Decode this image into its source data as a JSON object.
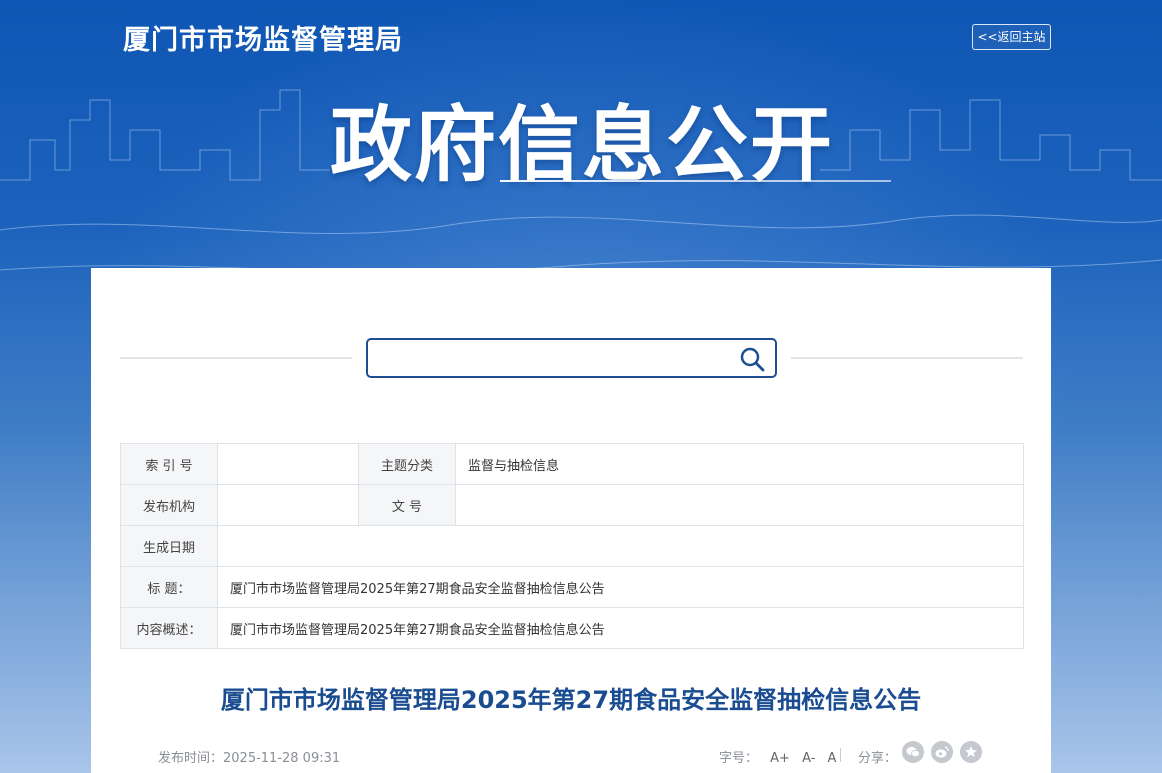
{
  "header": {
    "site_name": "厦门市市场监督管理局",
    "back_label": "<<返回主站",
    "banner_title": "政府信息公开"
  },
  "search": {
    "placeholder": ""
  },
  "meta_table": {
    "index_no_label": "索 引 号",
    "index_no_value": "",
    "topic_label": "主题分类",
    "topic_value": "监督与抽检信息",
    "publisher_label": "发布机构",
    "publisher_value": "",
    "doc_no_label": "文 号",
    "doc_no_value": "",
    "created_label": "生成日期",
    "created_value": "",
    "title_label": "标 题：",
    "title_value": "厦门市市场监督管理局2025年第27期食品安全监督抽检信息公告",
    "summary_label": "内容概述：",
    "summary_value": "厦门市市场监督管理局2025年第27期食品安全监督抽检信息公告"
  },
  "article": {
    "title": "厦门市市场监督管理局2025年第27期食品安全监督抽检信息公告",
    "publish_time": "发布时间：2025-11-28 09:31",
    "font_size_label": "字号：",
    "font_large": "A+",
    "font_medium": "A-",
    "font_default": "A",
    "share_label": "分享："
  },
  "colors": {
    "brand_blue": "#1a4c91",
    "banner_blue": "#0f56b4"
  },
  "icons": {
    "search": "search-icon",
    "wechat": "wechat-icon",
    "weibo": "weibo-icon",
    "favorite": "star-icon"
  }
}
